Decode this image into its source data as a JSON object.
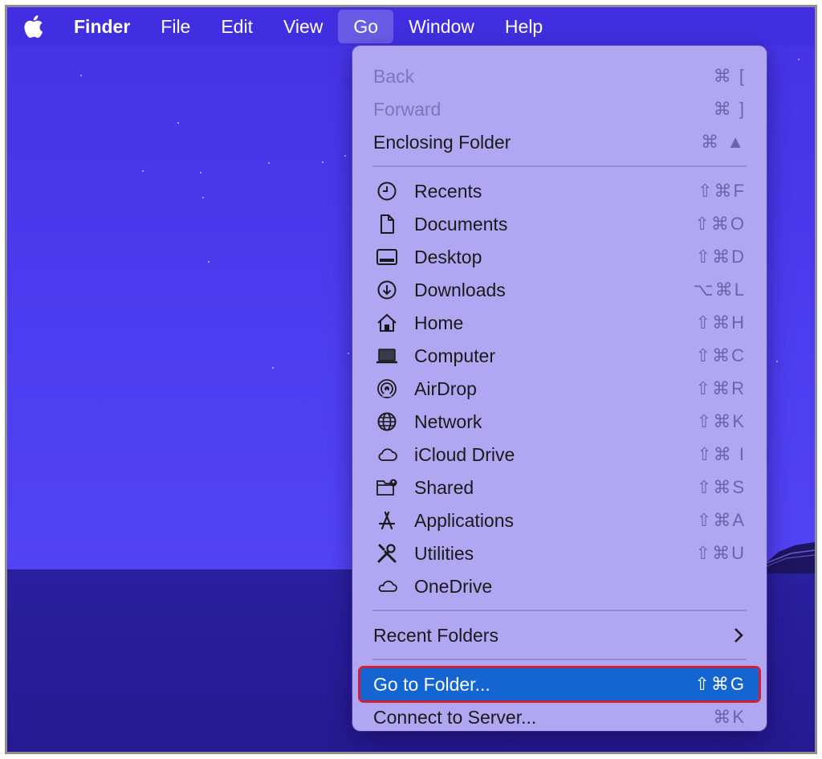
{
  "menubar": {
    "apple_icon": "apple-logo-icon",
    "items": [
      "Finder",
      "File",
      "Edit",
      "View",
      "Go",
      "Window",
      "Help"
    ]
  },
  "go_menu": {
    "nav": [
      {
        "label": "Back",
        "shortcut": "⌘ [",
        "disabled": true
      },
      {
        "label": "Forward",
        "shortcut": "⌘ ]",
        "disabled": true
      },
      {
        "label": "Enclosing Folder",
        "shortcut": "⌘ ▲",
        "disabled": false
      }
    ],
    "locations": [
      {
        "label": "Recents",
        "shortcut": "⇧⌘F",
        "icon": "clock-icon"
      },
      {
        "label": "Documents",
        "shortcut": "⇧⌘O",
        "icon": "document-icon"
      },
      {
        "label": "Desktop",
        "shortcut": "⇧⌘D",
        "icon": "desktop-icon"
      },
      {
        "label": "Downloads",
        "shortcut": "⌥⌘L",
        "icon": "download-icon"
      },
      {
        "label": "Home",
        "shortcut": "⇧⌘H",
        "icon": "home-icon"
      },
      {
        "label": "Computer",
        "shortcut": "⇧⌘C",
        "icon": "laptop-icon"
      },
      {
        "label": "AirDrop",
        "shortcut": "⇧⌘R",
        "icon": "airdrop-icon"
      },
      {
        "label": "Network",
        "shortcut": "⇧⌘K",
        "icon": "globe-icon"
      },
      {
        "label": "iCloud Drive",
        "shortcut": "⇧⌘ I",
        "icon": "cloud-icon"
      },
      {
        "label": "Shared",
        "shortcut": "⇧⌘S",
        "icon": "shared-folder-icon"
      },
      {
        "label": "Applications",
        "shortcut": "⇧⌘A",
        "icon": "applications-icon"
      },
      {
        "label": "Utilities",
        "shortcut": "⇧⌘U",
        "icon": "utilities-icon"
      },
      {
        "label": "OneDrive",
        "shortcut": "",
        "icon": "cloud-icon"
      }
    ],
    "recent_folders": "Recent Folders",
    "go_to_folder": {
      "label": "Go to Folder...",
      "shortcut": "⇧⌘G"
    },
    "connect_to_server": {
      "label": "Connect to Server...",
      "shortcut": "⌘K"
    }
  },
  "colors": {
    "selection": "#1464d2",
    "highlight_outline": "#cc1f3a",
    "menu_bg": "#b1a6f2",
    "desktop_sky": "#4b39e6",
    "desktop_sea": "#26198f"
  }
}
